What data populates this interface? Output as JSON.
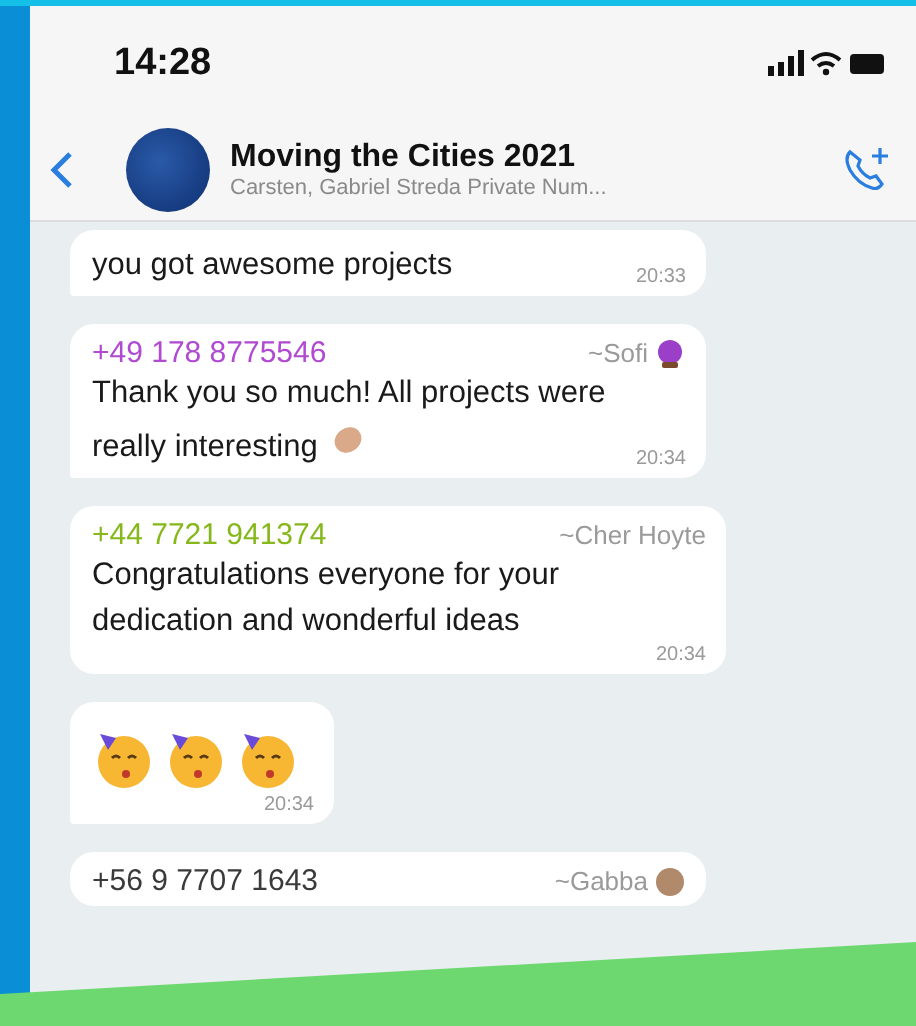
{
  "status_bar": {
    "time": "14:28"
  },
  "header": {
    "title": "Moving the Cities 2021",
    "subtitle": "Carsten, Gabriel Streda Private Num..."
  },
  "messages": [
    {
      "kind": "text",
      "text": "you got awesome projects",
      "time": "20:33",
      "tail": true
    },
    {
      "kind": "text",
      "sender": "+49 178 8775546",
      "color": "#b04ad0",
      "author": "~Sofi",
      "text": "Thank you so much! All projects were really interesting",
      "time": "20:34",
      "tail": true
    },
    {
      "kind": "text",
      "sender": "+44 7721 941374",
      "color": "#86b81c",
      "author": "~Cher Hoyte",
      "text": "Congratulations everyone for your dedication and wonderful ideas",
      "time": "20:34",
      "tail": false
    },
    {
      "kind": "emoji",
      "time": "20:34",
      "tail": true
    },
    {
      "kind": "text",
      "sender": "+56 9 7707 1643",
      "color": "#3a3a3a",
      "author": "~Gabba",
      "tail": false
    }
  ]
}
